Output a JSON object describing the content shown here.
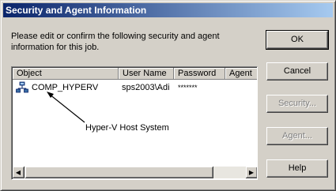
{
  "window": {
    "title": "Security and Agent Information"
  },
  "instruction": "Please edit or confirm the following security and agent information for this job.",
  "table": {
    "columns": [
      "Object",
      "User Name",
      "Password",
      "Agent"
    ],
    "rows": [
      {
        "object": "COMP_HYPERV",
        "user_name": "sps2003\\Adi",
        "password": "*******",
        "agent": ""
      }
    ]
  },
  "annotation": "Hyper-V Host System",
  "buttons": {
    "ok": "OK",
    "cancel": "Cancel",
    "security": "Security...",
    "agent": "Agent...",
    "help": "Help"
  },
  "icons": {
    "row_icon": "network-computer-icon",
    "scroll_left": "scroll-left-arrow-icon",
    "scroll_right": "scroll-right-arrow-icon"
  },
  "colors": {
    "titlebar_start": "#0a246a",
    "titlebar_end": "#a6caf0",
    "dialog_face": "#d4d0c8"
  }
}
